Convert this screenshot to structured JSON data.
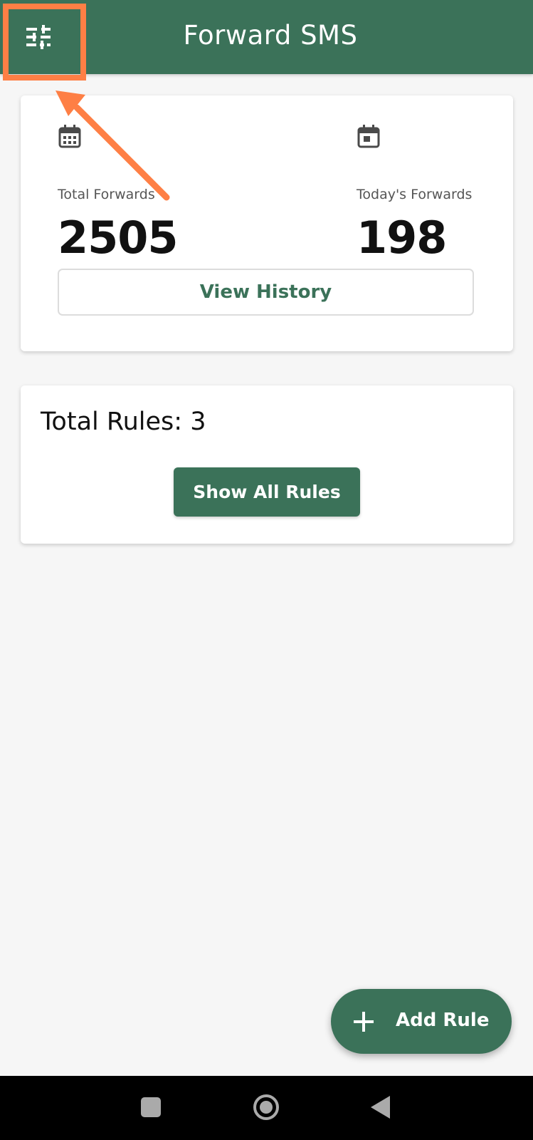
{
  "app_bar": {
    "title": "Forward SMS",
    "settings_icon": "tune-sliders-icon"
  },
  "stats": {
    "total": {
      "icon": "calendar-month-icon",
      "label": "Total Forwards",
      "value": "2505"
    },
    "today": {
      "icon": "calendar-today-icon",
      "label": "Today's Forwards",
      "value": "198"
    },
    "view_history_label": "View History"
  },
  "rules": {
    "total_label": "Total Rules: 3",
    "show_all_label": "Show All Rules"
  },
  "fab": {
    "icon": "plus-icon",
    "label": "Add Rule"
  },
  "nav": {
    "recents_icon": "square-recents-icon",
    "home_icon": "circle-home-icon",
    "back_icon": "triangle-back-icon"
  },
  "colors": {
    "primary": "#3b7259",
    "annotation": "#fe7f45",
    "background": "#f6f6f6"
  }
}
